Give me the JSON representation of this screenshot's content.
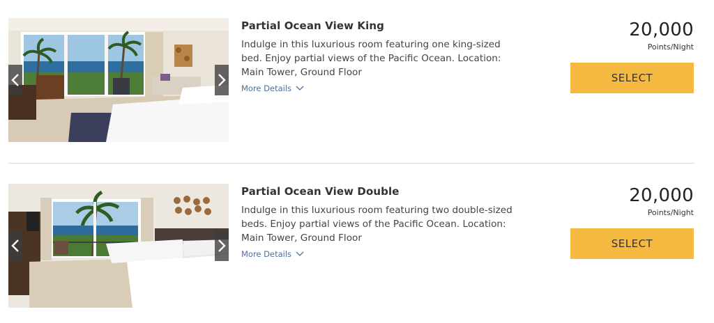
{
  "rooms": [
    {
      "title": "Partial Ocean View King",
      "description": "Indulge in this luxurious room featuring one king-sized bed. Enjoy partial views of the Pacific Ocean. Location: Main Tower, Ground Floor",
      "more_details": "More Details",
      "points": "20,000",
      "points_label": "Points/Night",
      "select_label": "SELECT"
    },
    {
      "title": "Partial Ocean View Double",
      "description": "Indulge in this luxurious room featuring two double-sized beds. Enjoy partial views of the Pacific Ocean. Location: Main Tower, Ground Floor",
      "more_details": "More Details",
      "points": "20,000",
      "points_label": "Points/Night",
      "select_label": "SELECT"
    }
  ],
  "icons": {
    "prev": "chevron-left-icon",
    "next": "chevron-right-icon",
    "expand": "chevron-down-icon"
  },
  "colors": {
    "select_button": "#f5b840",
    "link": "#4a6f9f",
    "divider": "#dcdcdc"
  }
}
